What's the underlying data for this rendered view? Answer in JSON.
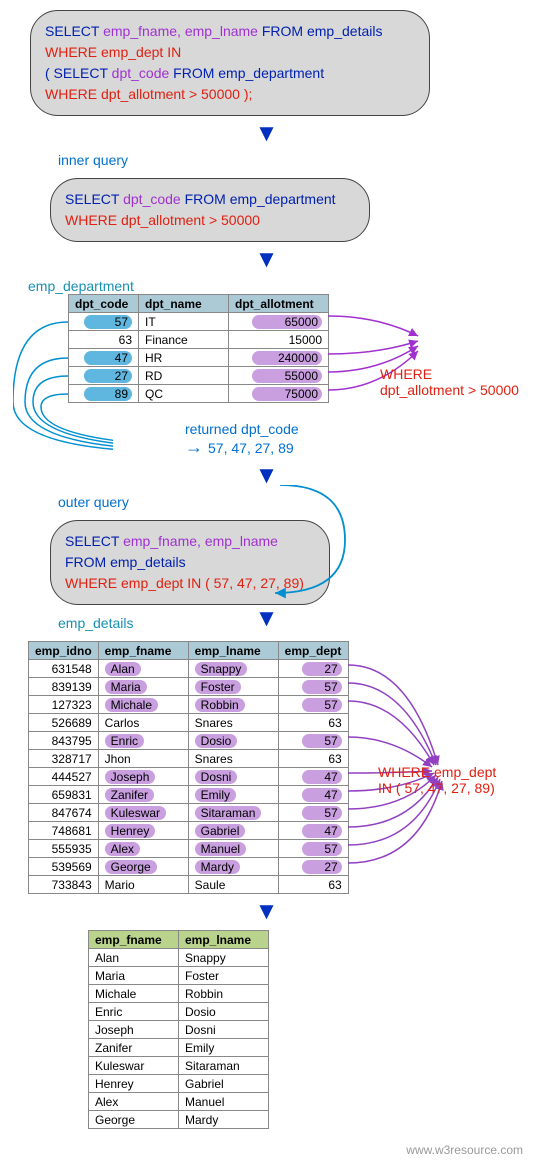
{
  "sql1": {
    "l1a": "SELECT",
    "l1b": "emp_fname, emp_lname",
    "l1c": "FROM",
    "l1d": "emp_details",
    "l2a": "WHERE",
    "l2b": "emp_dept",
    "l2c": "IN",
    "l3a": "( SELECT",
    "l3b": "dpt_code",
    "l3c": "FROM",
    "l3d": "emp_department",
    "l4a": "WHERE",
    "l4b": "dpt_allotment > 50000 );"
  },
  "labels": {
    "inner": "inner query",
    "emp_dept_tbl": "emp_department",
    "returned": "returned dpt_code",
    "returned_vals": "57, 47, 27, 89",
    "outer": "outer query",
    "emp_details_tbl": "emp_details"
  },
  "sql2": {
    "l1a": "SELECT",
    "l1b": "dpt_code",
    "l1c": "FROM",
    "l1d": "emp_department",
    "l2a": "WHERE",
    "l2b": "dpt_allotment > 50000"
  },
  "dept_table": {
    "headers": [
      "dpt_code",
      "dpt_name",
      "dpt_allotment"
    ],
    "rows": [
      {
        "code": "57",
        "name": "IT",
        "allot": "65000",
        "hl": true
      },
      {
        "code": "63",
        "name": "Finance",
        "allot": "15000",
        "hl": false
      },
      {
        "code": "47",
        "name": "HR",
        "allot": "240000",
        "hl": true
      },
      {
        "code": "27",
        "name": "RD",
        "allot": "55000",
        "hl": true
      },
      {
        "code": "89",
        "name": "QC",
        "allot": "75000",
        "hl": true
      }
    ]
  },
  "side1": {
    "a": "WHERE",
    "b": "dpt_allotment > 50000"
  },
  "sql3": {
    "l1a": "SELECT",
    "l1b": "emp_fname, emp_lname",
    "l2a": "FROM",
    "l2b": "emp_details",
    "l3a": "WHERE",
    "l3b": "emp_dept",
    "l3c": "IN",
    "l3d": "( 57, 47, 27, 89)"
  },
  "emp_table": {
    "headers": [
      "emp_idno",
      "emp_fname",
      "emp_lname",
      "emp_dept"
    ],
    "rows": [
      {
        "id": "631548",
        "f": "Alan",
        "l": "Snappy",
        "d": "27",
        "hl": true
      },
      {
        "id": "839139",
        "f": "Maria",
        "l": "Foster",
        "d": "57",
        "hl": true
      },
      {
        "id": "127323",
        "f": "Michale",
        "l": "Robbin",
        "d": "57",
        "hl": true
      },
      {
        "id": "526689",
        "f": "Carlos",
        "l": "Snares",
        "d": "63",
        "hl": false
      },
      {
        "id": "843795",
        "f": "Enric",
        "l": "Dosio",
        "d": "57",
        "hl": true
      },
      {
        "id": "328717",
        "f": "Jhon",
        "l": "Snares",
        "d": "63",
        "hl": false
      },
      {
        "id": "444527",
        "f": "Joseph",
        "l": "Dosni",
        "d": "47",
        "hl": true
      },
      {
        "id": "659831",
        "f": "Zanifer",
        "l": "Emily",
        "d": "47",
        "hl": true
      },
      {
        "id": "847674",
        "f": "Kuleswar",
        "l": "Sitaraman",
        "d": "57",
        "hl": true
      },
      {
        "id": "748681",
        "f": "Henrey",
        "l": "Gabriel",
        "d": "47",
        "hl": true
      },
      {
        "id": "555935",
        "f": "Alex",
        "l": "Manuel",
        "d": "57",
        "hl": true
      },
      {
        "id": "539569",
        "f": "George",
        "l": "Mardy",
        "d": "27",
        "hl": true
      },
      {
        "id": "733843",
        "f": "Mario",
        "l": "Saule",
        "d": "63",
        "hl": false
      }
    ]
  },
  "side2": {
    "a": "WHERE",
    "b": "emp_dept",
    "c": "IN",
    "d": "( 57, 47, 27, 89)"
  },
  "result_table": {
    "headers": [
      "emp_fname",
      "emp_lname"
    ],
    "rows": [
      [
        "Alan",
        "Snappy"
      ],
      [
        "Maria",
        "Foster"
      ],
      [
        "Michale",
        "Robbin"
      ],
      [
        "Enric",
        "Dosio"
      ],
      [
        "Joseph",
        "Dosni"
      ],
      [
        "Zanifer",
        "Emily"
      ],
      [
        "Kuleswar",
        "Sitaraman"
      ],
      [
        "Henrey",
        "Gabriel"
      ],
      [
        "Alex",
        "Manuel"
      ],
      [
        "George",
        "Mardy"
      ]
    ]
  },
  "footer": "www.w3resource.com"
}
